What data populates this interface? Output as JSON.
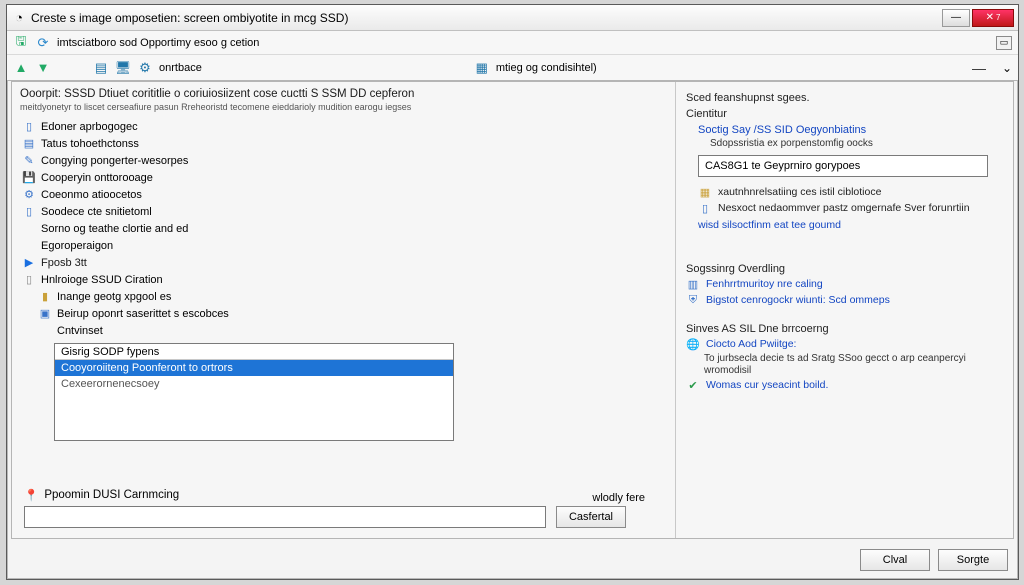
{
  "titlebar": {
    "text": "Creste s image omposetien: screen ombiyotite in mcg SSD)"
  },
  "toolbar1": {
    "breadcrumb": "imtsciatboro sod Opportimy esoo g cetion"
  },
  "toolbar2": {
    "label_a": "onrtbace",
    "center": "mtieg og condisihtel)"
  },
  "left": {
    "heading": "Ooorpit: SSSD Dtiuet corititlie o coriuiosiizent cose cuctti S SSM DD cepferon",
    "sub": "meitdyonetyr to liscet cerseafiure pasun Rreheoristd tecomene eieddarioly mudition earogu iegses",
    "tree": [
      {
        "icon": "📄",
        "label": "Edoner aprbogogec",
        "level": 0
      },
      {
        "icon": "📋",
        "label": "Tatus tohoethctonss",
        "level": 0
      },
      {
        "icon": "🔧",
        "label": "Congying pongerter-wesorpes",
        "level": 0
      },
      {
        "icon": "💾",
        "label": "Cooperyin onttorooage",
        "level": 0
      },
      {
        "icon": "⚙",
        "label": "Coeonmo atioocetos",
        "level": 0
      },
      {
        "icon": "📑",
        "label": "Soodece cte snitietoml",
        "level": 0
      },
      {
        "icon": "",
        "label": "Sorno og teathe clortie and ed",
        "level": 0
      },
      {
        "icon": "",
        "label": "Egoroperaigon",
        "level": 0
      },
      {
        "icon": "▶",
        "label": "Fposb 3tt",
        "level": 0,
        "blue": true
      },
      {
        "icon": "📄",
        "label": "Hnlroioge SSUD Ciration",
        "level": 0
      },
      {
        "icon": "📁",
        "label": "Inange geotg xpgool es",
        "level": 1
      },
      {
        "icon": "📦",
        "label": "Beirup oponrt saserittet s escobces",
        "level": 1
      },
      {
        "icon": "",
        "label": "Cntvinset",
        "level": 1
      }
    ],
    "list": {
      "header": "Gisrig SODP fypens",
      "selected": "Cooyoroiiteng   Poonferont  to ortrors",
      "second": "Cexeerornenecsoey"
    },
    "bottom": {
      "label": "Ppoomin DUSI Carnmcing",
      "wool": "wlodly fere",
      "btn": "Casfertal"
    }
  },
  "right": {
    "top1": "Sced feanshupnst sgees.",
    "top2": "Cientitur",
    "linkA": "Soctig Say /SS SID Oegyonbiatins",
    "sub1": "Sdopssristia ex porpenstomfig oocks",
    "input_val": "CAS8G1 te Geyprniro gorypoes",
    "row1": "xautnhnrelsatiing ces istil ciblotioce",
    "row2": "Nesxoct nedaommver pastz omgernafe Sver forunrtiin",
    "row3": "wisd silsoctfinm eat tee goumd",
    "sec2": "Sogssinrg Overdling",
    "sec2a": "Fenhrrtmuritoy nre caling",
    "sec2b": "Bigstot cenrogockr wiunti: Scd ommeps",
    "sec3": "Sinves AS SIL Dne brrcoerng",
    "sec3a": "Ciocto Aod Pwiitge:",
    "sec3b": "To jurbsecla decie ts ad Sratg SSoo gecct o arp ceanpercyi wromodisil",
    "sec3c": "Womas cur yseacint boild."
  },
  "footer": {
    "b1": "Clval",
    "b2": "Sorgte"
  }
}
